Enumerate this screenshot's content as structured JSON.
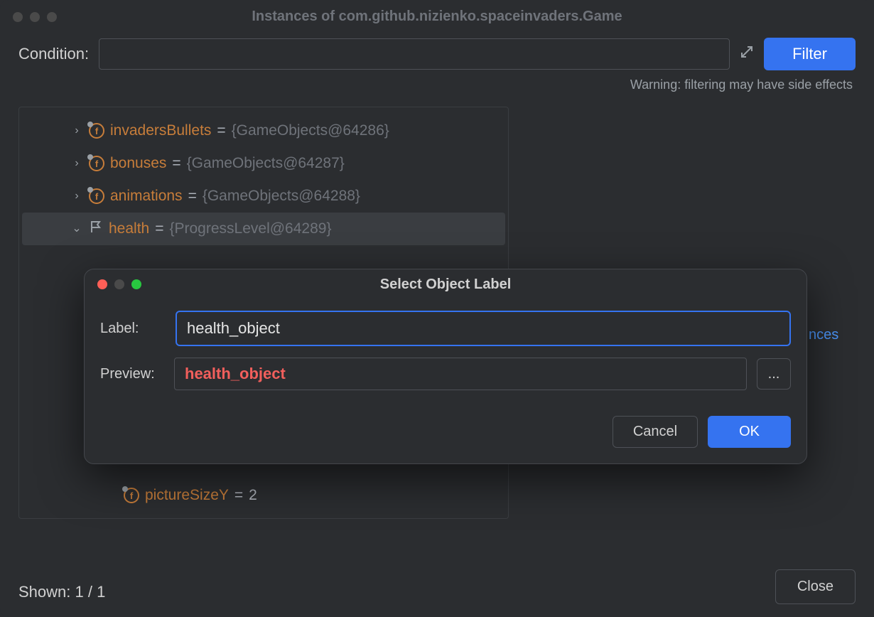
{
  "window": {
    "title": "Instances of com.github.nizienko.spaceinvaders.Game"
  },
  "condition": {
    "label": "Condition:",
    "value": "",
    "filter_button": "Filter",
    "warning": "Warning: filtering may have side effects"
  },
  "tree": {
    "rows": [
      {
        "name": "invadersBullets",
        "value": "{GameObjects@64286}",
        "expanded": false
      },
      {
        "name": "bonuses",
        "value": "{GameObjects@64287}",
        "expanded": false
      },
      {
        "name": "animations",
        "value": "{GameObjects@64288}",
        "expanded": false
      },
      {
        "name": "health",
        "value": "{ProgressLevel@64289}",
        "expanded": true,
        "flagged": true
      }
    ],
    "sub": {
      "name": "pictureSizeY",
      "value": "2"
    }
  },
  "link": "nces",
  "shown": "Shown: 1 / 1",
  "close": "Close",
  "dialog": {
    "title": "Select Object Label",
    "label_text": "Label:",
    "label_value": "health_object",
    "preview_text": "Preview:",
    "preview_value": "health_object",
    "more": "...",
    "cancel": "Cancel",
    "ok": "OK"
  }
}
